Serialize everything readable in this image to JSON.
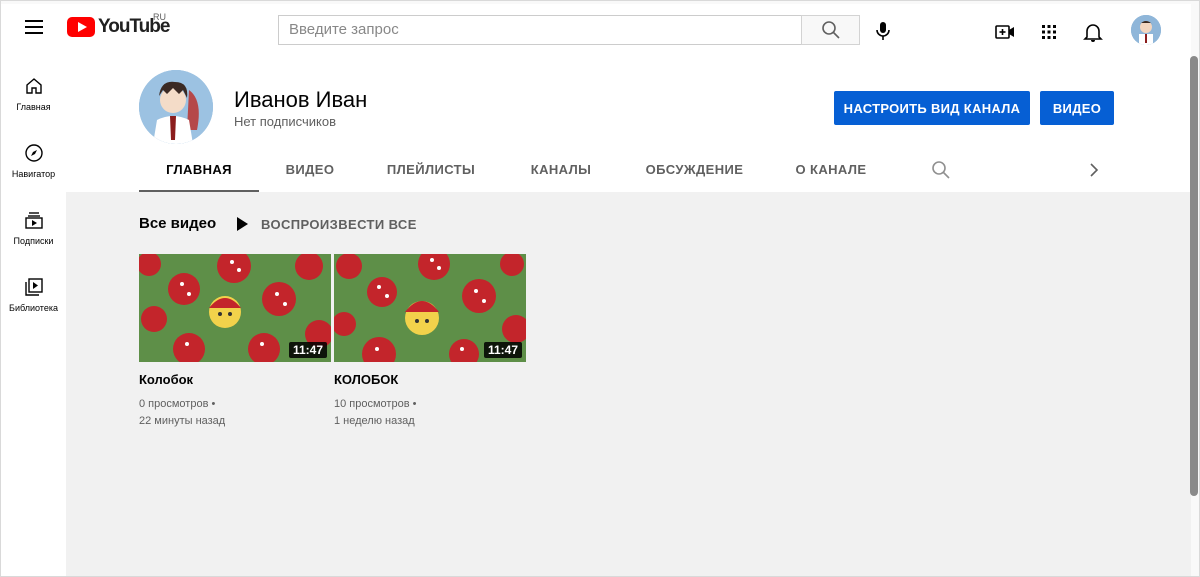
{
  "topbar": {
    "logo_text": "YouTube",
    "logo_region": "RU",
    "search_placeholder": "Введите запрос"
  },
  "sidebar": {
    "items": [
      {
        "label": "Главная",
        "icon": "home-icon"
      },
      {
        "label": "Навигатор",
        "icon": "compass-icon"
      },
      {
        "label": "Подписки",
        "icon": "subscriptions-icon"
      },
      {
        "label": "Библиотека",
        "icon": "library-icon"
      }
    ]
  },
  "channel": {
    "name": "Иванов Иван",
    "subscribers": "Нет подписчиков",
    "customize_label": "НАСТРОИТЬ ВИД КАНАЛА",
    "videos_label": "ВИДЕО"
  },
  "tabs": [
    {
      "label": "ГЛАВНАЯ",
      "active": true
    },
    {
      "label": "ВИДЕО",
      "active": false
    },
    {
      "label": "ПЛЕЙЛИСТЫ",
      "active": false
    },
    {
      "label": "КАНАЛЫ",
      "active": false
    },
    {
      "label": "ОБСУЖДЕНИЕ",
      "active": false
    },
    {
      "label": "О КАНАЛЕ",
      "active": false
    }
  ],
  "section": {
    "title": "Все видео",
    "play_all": "ВОСПРОИЗВЕСТИ ВСЕ"
  },
  "videos": [
    {
      "title": "Колобок",
      "duration": "11:47",
      "views": "0 просмотров •",
      "age": "22 минуты назад"
    },
    {
      "title": "КОЛОБОК",
      "duration": "11:47",
      "views": "10 просмотров •",
      "age": "1 неделю назад"
    }
  ],
  "colors": {
    "accent": "#065fd4",
    "brand_red": "#ff0000"
  }
}
